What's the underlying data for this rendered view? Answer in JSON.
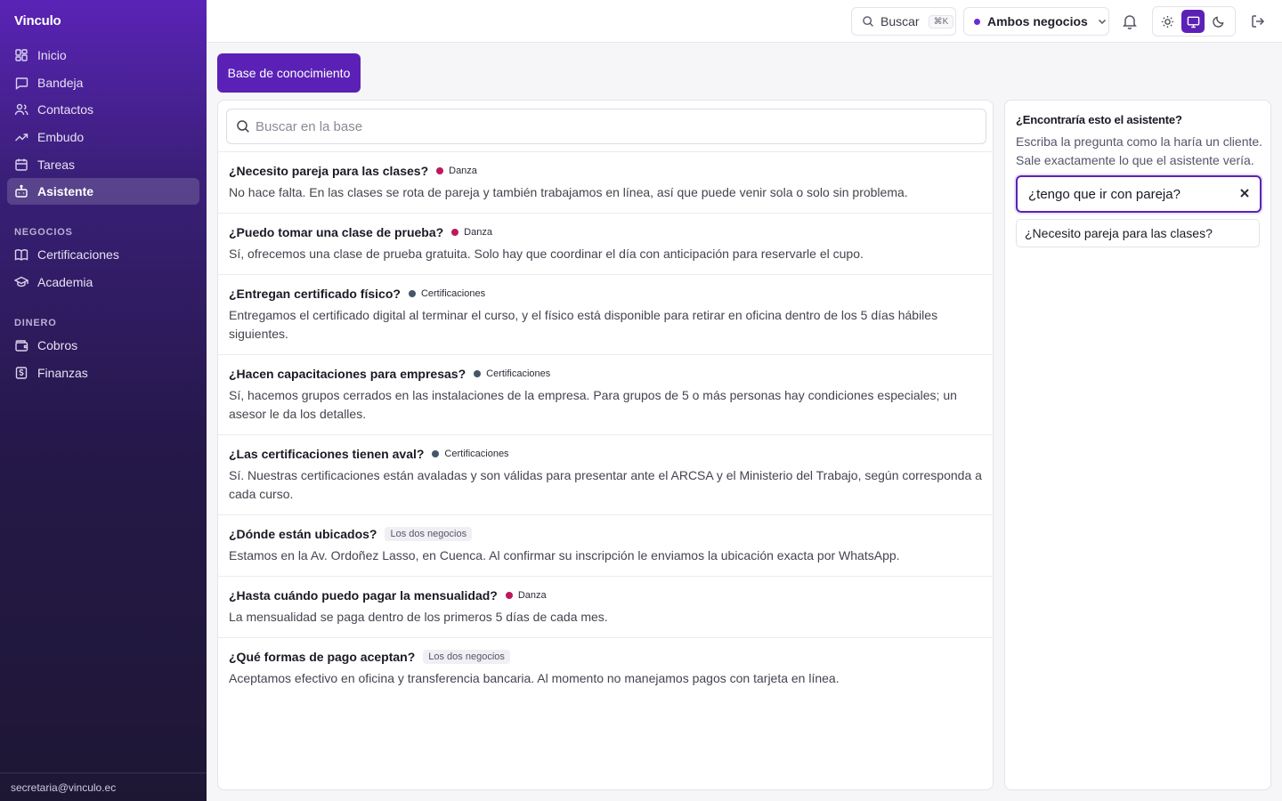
{
  "brand": "Vinculo",
  "sidebar": {
    "items": [
      {
        "label": "Inicio",
        "icon": "dashboard-icon"
      },
      {
        "label": "Bandeja",
        "icon": "message-icon"
      },
      {
        "label": "Contactos",
        "icon": "users-icon"
      },
      {
        "label": "Embudo",
        "icon": "trending-up-icon"
      },
      {
        "label": "Tareas",
        "icon": "calendar-icon"
      },
      {
        "label": "Asistente",
        "icon": "bot-icon",
        "active": true
      }
    ],
    "section_negocios": "NEGOCIOS",
    "negocios": [
      {
        "label": "Certificaciones",
        "icon": "book-icon"
      },
      {
        "label": "Academia",
        "icon": "graduation-cap-icon"
      }
    ],
    "section_dinero": "DINERO",
    "dinero": [
      {
        "label": "Cobros",
        "icon": "wallet-icon"
      },
      {
        "label": "Finanzas",
        "icon": "receipt-icon"
      }
    ],
    "footer_email": "secretaria@vinculo.ec"
  },
  "topbar": {
    "search_label": "Buscar",
    "search_shortcut": "⌘K",
    "business_select": "Ambos negocios",
    "theme_active": "system"
  },
  "page": {
    "header_button": "Base de conocimiento",
    "search_placeholder": "Buscar en la base"
  },
  "colors": {
    "accent": "#5b21b6",
    "danza": "#be185d",
    "certificaciones": "#475569"
  },
  "entries": [
    {
      "question": "¿Necesito pareja para las clases?",
      "tag": "Danza",
      "tag_type": "danza",
      "answer": "No hace falta. En las clases se rota de pareja y también trabajamos en línea, así que puede venir sola o solo sin problema."
    },
    {
      "question": "¿Puedo tomar una clase de prueba?",
      "tag": "Danza",
      "tag_type": "danza",
      "answer": "Sí, ofrecemos una clase de prueba gratuita. Solo hay que coordinar el día con anticipación para reservarle el cupo."
    },
    {
      "question": "¿Entregan certificado físico?",
      "tag": "Certificaciones",
      "tag_type": "cert",
      "answer": "Entregamos el certificado digital al terminar el curso, y el físico está disponible para retirar en oficina dentro de los 5 días hábiles siguientes."
    },
    {
      "question": "¿Hacen capacitaciones para empresas?",
      "tag": "Certificaciones",
      "tag_type": "cert",
      "answer": "Sí, hacemos grupos cerrados en las instalaciones de la empresa. Para grupos de 5 o más personas hay condiciones especiales; un asesor le da los detalles."
    },
    {
      "question": "¿Las certificaciones tienen aval?",
      "tag": "Certificaciones",
      "tag_type": "cert",
      "answer": "Sí. Nuestras certificaciones están avaladas y son válidas para presentar ante el ARCSA y el Ministerio del Trabajo, según corresponda a cada curso."
    },
    {
      "question": "¿Dónde están ubicados?",
      "tag": "Los dos negocios",
      "tag_type": "both",
      "answer": "Estamos en la Av. Ordoñez Lasso, en Cuenca. Al confirmar su inscripción le enviamos la ubicación exacta por WhatsApp."
    },
    {
      "question": "¿Hasta cuándo puedo pagar la mensualidad?",
      "tag": "Danza",
      "tag_type": "danza",
      "answer": "La mensualidad se paga dentro de los primeros 5 días de cada mes."
    },
    {
      "question": "¿Qué formas de pago aceptan?",
      "tag": "Los dos negocios",
      "tag_type": "both",
      "answer": "Aceptamos efectivo en oficina y transferencia bancaria. Al momento no manejamos pagos con tarjeta en línea."
    }
  ],
  "tester": {
    "title": "¿Encontraría esto el asistente?",
    "description": "Escriba la pregunta como la haría un cliente. Sale exactamente lo que el asistente vería.",
    "input_value": "¿tengo que ir con pareja?",
    "result": "¿Necesito pareja para las clases?"
  }
}
